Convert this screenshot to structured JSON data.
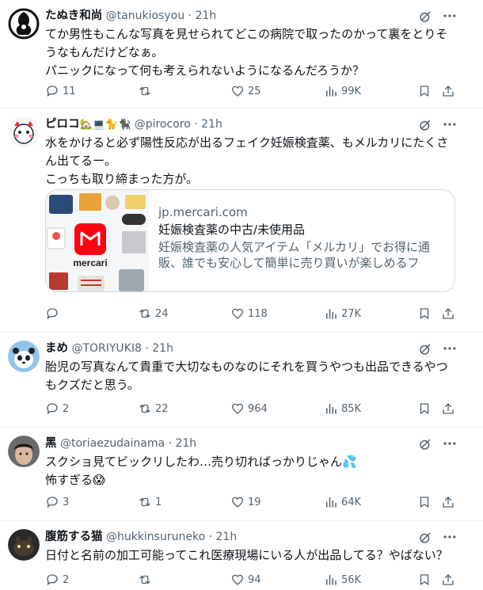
{
  "posts": [
    {
      "name": "たぬき和尚",
      "handle": "@tanukiosyou",
      "time": "21h",
      "lines": [
        "てか男性もこんな写真を見せられてどこの病院で取ったのかって裏をとりそ",
        "うなもんだけどなぁ。",
        "パニックになって何も考えられないようになるんだろうか？"
      ],
      "replies": "11",
      "reposts": "",
      "likes": "25",
      "views": "99K"
    },
    {
      "name": "ピロコ",
      "name_emoji": "🏡💻🐈🐈‍⬛",
      "handle": "@pirocoro",
      "time": "21h",
      "lines": [
        "水をかけると必ず陽性反応が出るフェイク妊娠検査薬、もメルカリにたくさ",
        "ん出てるー。",
        "こっちも取り締まった方が。"
      ],
      "card": {
        "domain": "jp.mercari.com",
        "title": "妊娠検査薬の中古/未使用品",
        "desc": "妊娠検査薬の人気アイテム「メルカリ」でお得に通販、誰でも安心して簡単に売り買いが楽しめるフリ...",
        "logo_text": "mercari"
      },
      "replies": "",
      "reposts": "24",
      "likes": "118",
      "views": "27K"
    },
    {
      "name": "まめ",
      "handle": "@TORIYUKI8",
      "time": "21h",
      "lines": [
        "胎児の写真なんて貴重で大切なものなのにそれを買うやつも出品できるやつ",
        "もクズだと思う。"
      ],
      "replies": "2",
      "reposts": "22",
      "likes": "964",
      "views": "85K"
    },
    {
      "name": "黑",
      "handle": "@toriaezudainama",
      "time": "21h",
      "lines": [
        "スクショ見てビックリしたわ…売り切ればっかりじゃん💦",
        "怖すぎる😱"
      ],
      "replies": "3",
      "reposts": "1",
      "likes": "19",
      "views": "64K"
    },
    {
      "name": "腹筋する猫",
      "handle": "@hukkinsuruneko",
      "time": "21h",
      "lines": [
        "日付と名前の加工可能ってこれ医療現場にいる人が出品してる？やばない？"
      ],
      "replies": "2",
      "reposts": "",
      "likes": "94",
      "views": "56K"
    }
  ],
  "separator": "·",
  "colors": {
    "text": "#0f1419",
    "secondary": "#536471",
    "border": "#eff3f4",
    "card_border": "#cfd9de",
    "mercari_red": "#ff0211"
  },
  "icons": [
    "reply-icon",
    "repost-icon",
    "like-icon",
    "views-icon",
    "bookmark-icon",
    "share-icon",
    "grok-icon",
    "more-icon"
  ]
}
